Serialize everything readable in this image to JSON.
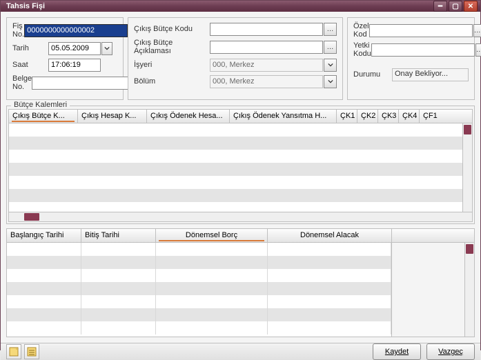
{
  "window": {
    "title": "Tahsis Fişi"
  },
  "left": {
    "fisno_label": "Fiş No.",
    "fisno_value": "0000000000000002",
    "tarih_label": "Tarih",
    "tarih_value": "05.05.2009",
    "saat_label": "Saat",
    "saat_value": "17:06:19",
    "belgeno_label": "Belge No.",
    "belgeno_value": ""
  },
  "mid": {
    "cikis_butce_kodu_label": "Çıkış Bütçe Kodu",
    "cikis_butce_kodu_value": "",
    "cikis_butce_acik_label": "Çıkış Bütçe Açıklaması",
    "cikis_butce_acik_value": "",
    "isyeri_label": "İşyeri",
    "isyeri_value": "000, Merkez",
    "bolum_label": "Bölüm",
    "bolum_value": "000, Merkez"
  },
  "right": {
    "ozel_kod_label": "Özel Kod",
    "ozel_kod_value": "",
    "yetki_kodu_label": "Yetki Kodu",
    "yetki_kodu_value": "",
    "durumu_label": "Durumu",
    "durumu_value": "Onay Bekliyor..."
  },
  "grid1": {
    "legend": "Bütçe Kalemleri",
    "cols": {
      "c1": "Çıkış Bütçe K...",
      "c2": "Çıkış Hesap K...",
      "c3": "Çıkış Ödenek Hesa...",
      "c4": "Çıkış Ödenek Yansıtma H...",
      "ck1": "ÇK1",
      "ck2": "ÇK2",
      "ck3": "ÇK3",
      "ck4": "ÇK4",
      "cf1": "ÇF1"
    }
  },
  "grid2": {
    "cols": {
      "start": "Başlangıç Tarihi",
      "end": "Bitiş Tarihi",
      "borc": "Dönemsel Borç",
      "alacak": "Dönemsel Alacak"
    }
  },
  "buttons": {
    "save": "Kaydet",
    "cancel": "Vazgeç"
  },
  "icons": {
    "ellipsis": "…",
    "note1": "note-yellow-icon",
    "note2": "note-lines-icon"
  }
}
